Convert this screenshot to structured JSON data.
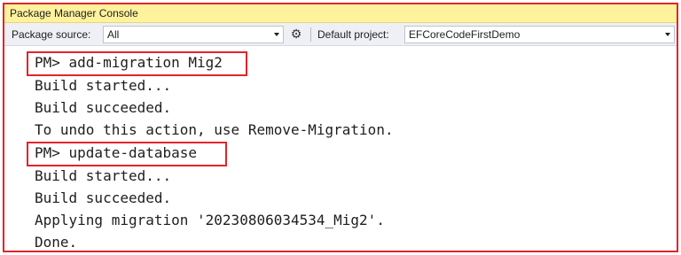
{
  "window": {
    "title": "Package Manager Console"
  },
  "toolbar": {
    "package_source_label": "Package source:",
    "package_source_value": "All",
    "settings_icon": "gear-icon",
    "default_project_label": "Default project:",
    "default_project_value": "EFCoreCodeFirstDemo"
  },
  "console": {
    "lines": [
      "PM> add-migration Mig2",
      "Build started...",
      "Build succeeded.",
      "To undo this action, use Remove-Migration.",
      "PM> update-database",
      "Build started...",
      "Build succeeded.",
      "Applying migration '20230806034534_Mig2'.",
      "Done."
    ]
  },
  "colors": {
    "highlight_border": "#e3242b",
    "titlebar_bg": "#fff29d",
    "toolbar_bg": "#eef0f5"
  }
}
